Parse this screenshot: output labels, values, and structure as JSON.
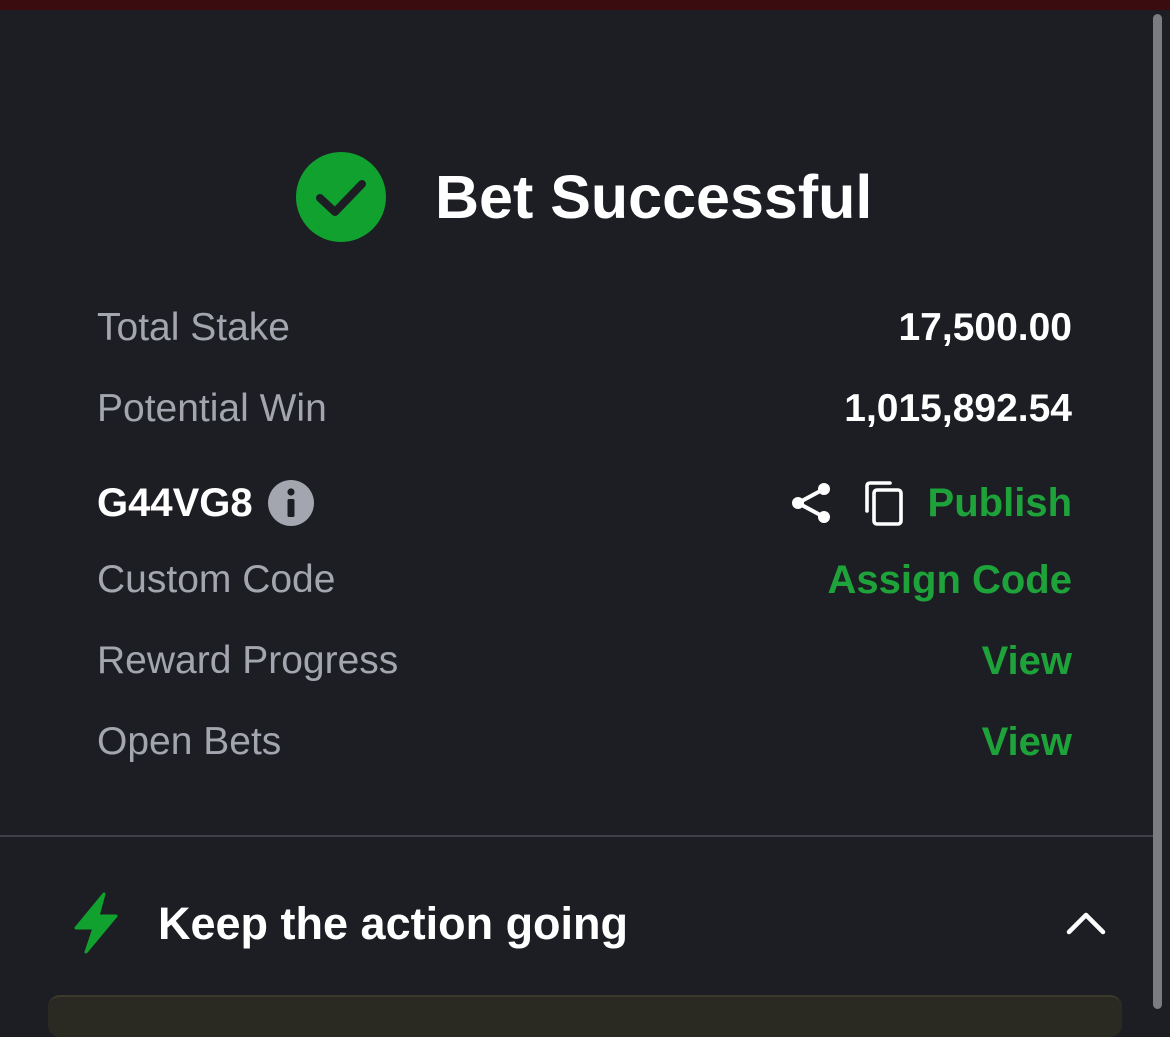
{
  "header": {
    "title": "Bet Successful",
    "icon": "check-circle-icon",
    "accent": "#11a12f"
  },
  "details": {
    "total_stake": {
      "label": "Total Stake",
      "value": "17,500.00"
    },
    "potential_win": {
      "label": "Potential Win",
      "value": "1,015,892.54"
    },
    "booking": {
      "code": "G44VG8",
      "info_icon": "info-icon",
      "share_icon": "share-icon",
      "copy_icon": "copy-icon",
      "publish_label": "Publish"
    },
    "custom_code": {
      "label": "Custom Code",
      "action": "Assign Code"
    },
    "reward_progress": {
      "label": "Reward Progress",
      "action": "View"
    },
    "open_bets": {
      "label": "Open Bets",
      "action": "View"
    }
  },
  "promo": {
    "title": "Keep the action going",
    "icon": "lightning-bolt-icon",
    "toggle_icon": "chevron-up-icon"
  },
  "colors": {
    "background": "#1c1e24",
    "link": "#1ea33b",
    "label": "#a3a6ae",
    "value": "#ffffff"
  }
}
